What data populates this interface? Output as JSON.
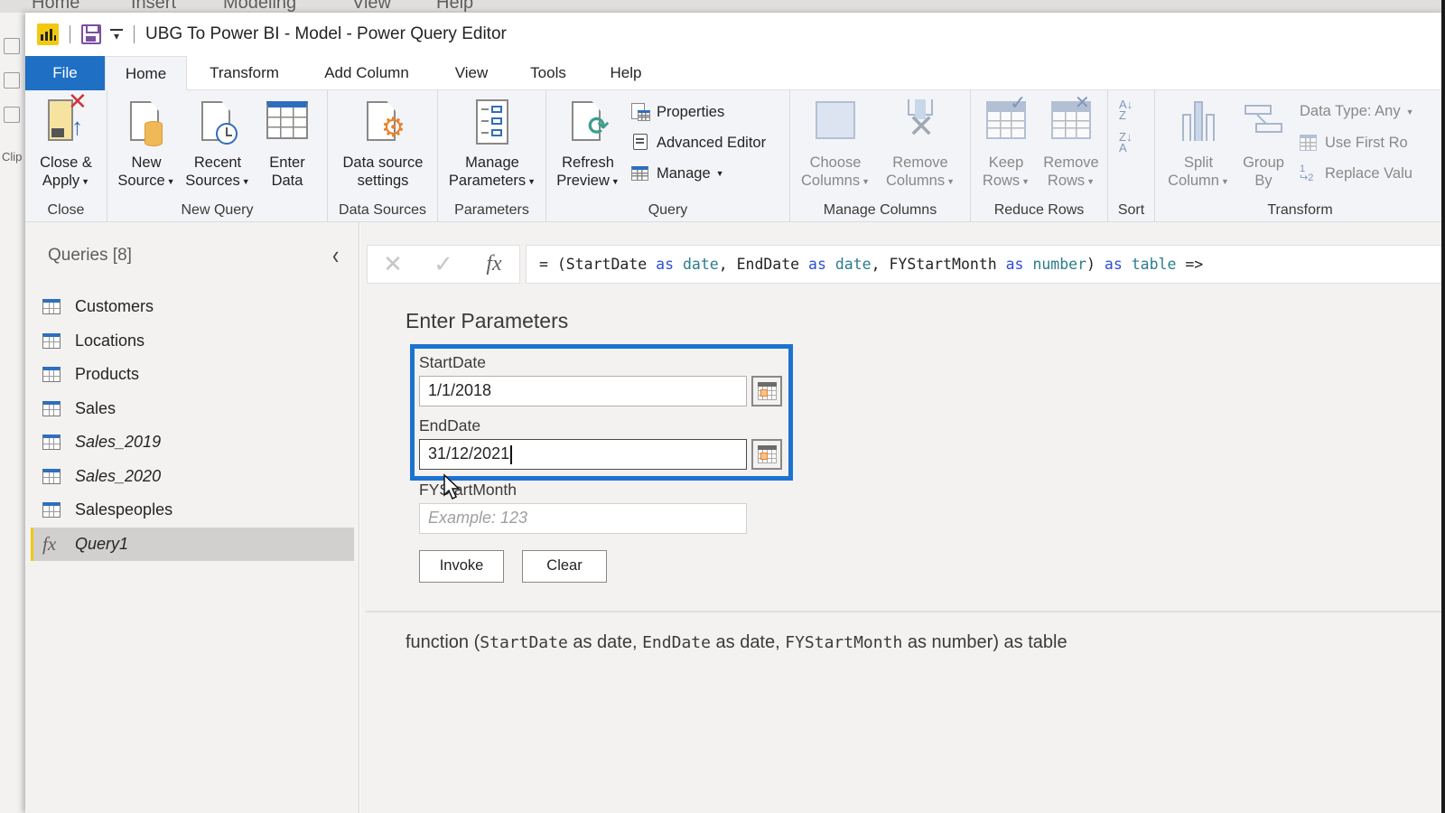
{
  "host_app": {
    "menu": [
      "Home",
      "Insert",
      "Modeling",
      "View",
      "Help"
    ],
    "left_label": "Clip"
  },
  "window": {
    "title": "UBG To Power BI - Model - Power Query Editor",
    "logo": "power-bi-logo",
    "save_icon": "save-icon",
    "qat_icon": "customize-quick-access-icon"
  },
  "tabs": [
    {
      "label": "File",
      "active": false
    },
    {
      "label": "Home",
      "active": true
    },
    {
      "label": "Transform",
      "active": false
    },
    {
      "label": "Add Column",
      "active": false
    },
    {
      "label": "View",
      "active": false
    },
    {
      "label": "Tools",
      "active": false
    },
    {
      "label": "Help",
      "active": false
    }
  ],
  "ribbon": {
    "close": {
      "group_label": "Close",
      "close_apply": {
        "line1": "Close &",
        "line2": "Apply",
        "icon": "close-apply-icon",
        "dropdown": true
      }
    },
    "new_query": {
      "group_label": "New Query",
      "new_source": {
        "line1": "New",
        "line2": "Source",
        "icon": "new-source-icon",
        "dropdown": true
      },
      "recent_sources": {
        "line1": "Recent",
        "line2": "Sources",
        "icon": "recent-sources-icon",
        "dropdown": true
      },
      "enter_data": {
        "line1": "Enter",
        "line2": "Data",
        "icon": "enter-data-icon"
      }
    },
    "data_sources": {
      "group_label": "Data Sources",
      "settings": {
        "line1": "Data source",
        "line2": "settings",
        "icon": "data-source-settings-icon"
      }
    },
    "parameters": {
      "group_label": "Parameters",
      "manage": {
        "line1": "Manage",
        "line2": "Parameters",
        "icon": "manage-parameters-icon",
        "dropdown": true
      }
    },
    "query": {
      "group_label": "Query",
      "refresh": {
        "line1": "Refresh",
        "line2": "Preview",
        "icon": "refresh-preview-icon",
        "dropdown": true
      },
      "properties": "Properties",
      "advanced_editor": "Advanced Editor",
      "manage": "Manage"
    },
    "manage_columns": {
      "group_label": "Manage Columns",
      "choose": {
        "line1": "Choose",
        "line2": "Columns",
        "disabled": true
      },
      "remove": {
        "line1": "Remove",
        "line2": "Columns",
        "disabled": true
      }
    },
    "reduce_rows": {
      "group_label": "Reduce Rows",
      "keep": {
        "line1": "Keep",
        "line2": "Rows",
        "disabled": true
      },
      "remove": {
        "line1": "Remove",
        "line2": "Rows",
        "disabled": true
      }
    },
    "sort": {
      "group_label": "Sort",
      "asc_icon": "A↓Z",
      "desc_icon": "Z↓A"
    },
    "transform": {
      "group_label": "Transform",
      "split": {
        "line1": "Split",
        "line2": "Column",
        "disabled": true
      },
      "group_by": {
        "line1": "Group",
        "line2": "By",
        "disabled": true
      },
      "data_type": "Data Type: Any",
      "use_first_row": "Use First Ro",
      "replace_values": "Replace Valu"
    }
  },
  "sidebar": {
    "title": "Queries [8]",
    "collapse_icon": "‹",
    "items": [
      {
        "label": "Customers",
        "type": "table",
        "italic": false,
        "selected": false
      },
      {
        "label": "Locations",
        "type": "table",
        "italic": false,
        "selected": false
      },
      {
        "label": "Products",
        "type": "table",
        "italic": false,
        "selected": false
      },
      {
        "label": "Sales",
        "type": "table",
        "italic": false,
        "selected": false
      },
      {
        "label": "Sales_2019",
        "type": "table",
        "italic": true,
        "selected": false
      },
      {
        "label": "Sales_2020",
        "type": "table",
        "italic": true,
        "selected": false
      },
      {
        "label": "Salespeoples",
        "type": "table",
        "italic": false,
        "selected": false
      },
      {
        "label": "Query1",
        "type": "function",
        "italic": true,
        "selected": true
      }
    ]
  },
  "formula_bar": {
    "cancel_icon": "✕",
    "commit_icon": "✓",
    "fx_label": "fx",
    "tokens": [
      {
        "t": "= (StartDate ",
        "c": ""
      },
      {
        "t": "as",
        "c": "kw"
      },
      {
        "t": " ",
        "c": ""
      },
      {
        "t": "date",
        "c": "ty"
      },
      {
        "t": ", EndDate ",
        "c": ""
      },
      {
        "t": "as",
        "c": "kw"
      },
      {
        "t": " ",
        "c": ""
      },
      {
        "t": "date",
        "c": "ty"
      },
      {
        "t": ", FYStartMonth ",
        "c": ""
      },
      {
        "t": "as",
        "c": "kw"
      },
      {
        "t": " ",
        "c": ""
      },
      {
        "t": "number",
        "c": "ty"
      },
      {
        "t": ") ",
        "c": ""
      },
      {
        "t": "as",
        "c": "kw"
      },
      {
        "t": " ",
        "c": ""
      },
      {
        "t": "table",
        "c": "ty"
      },
      {
        "t": " =>",
        "c": ""
      }
    ]
  },
  "parameters_panel": {
    "title": "Enter Parameters",
    "params": [
      {
        "label": "StartDate",
        "value": "1/1/2018",
        "placeholder": "",
        "has_calendar": true
      },
      {
        "label": "EndDate",
        "value": "31/12/2021",
        "placeholder": "",
        "has_calendar": true,
        "focused": true
      },
      {
        "label": "FYStartMonth",
        "value": "",
        "placeholder": "Example: 123",
        "has_calendar": false
      }
    ],
    "invoke_label": "Invoke",
    "clear_label": "Clear",
    "highlight_color": "#1c73cf"
  },
  "signature": {
    "parts": [
      {
        "t": "function (",
        "mono": false
      },
      {
        "t": "StartDate",
        "mono": true
      },
      {
        "t": " as date, ",
        "mono": false
      },
      {
        "t": "EndDate",
        "mono": true
      },
      {
        "t": " as date, ",
        "mono": false
      },
      {
        "t": "FYStartMonth",
        "mono": true
      },
      {
        "t": " as number) as table",
        "mono": false
      }
    ]
  },
  "colors": {
    "file_tab": "#1f6fc5",
    "selected_query_accent": "#f2c811",
    "keyword": "#2f4fd8",
    "type": "#2a7d8c"
  }
}
